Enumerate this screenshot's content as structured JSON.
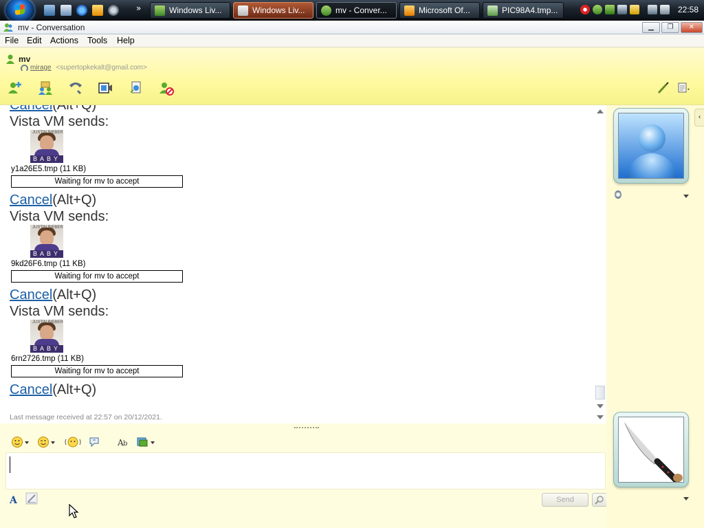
{
  "taskbar": {
    "overflow": "»",
    "buttons": [
      {
        "label": "Windows Liv..."
      },
      {
        "label": "Windows Liv..."
      },
      {
        "label": "mv - Conver..."
      },
      {
        "label": "Microsoft Of..."
      },
      {
        "label": "PIC98A4.tmp..."
      }
    ],
    "clock": "22:58"
  },
  "window": {
    "title": "mv - Conversation",
    "minimize": "▁",
    "restore": "❐",
    "close": "✕"
  },
  "menu": [
    "File",
    "Edit",
    "Actions",
    "Tools",
    "Help"
  ],
  "contact": {
    "name": "mv",
    "nickname": "mirage",
    "email": "<supertopkekalt@gmail.com>"
  },
  "history": {
    "first_cancel": "Cancel",
    "first_shortcut": "(Alt+Q)",
    "transfers": [
      {
        "sender": "Vista VM sends:",
        "thumb_caption": "BABY",
        "thumb_topline": "JUSTIN BIEBER",
        "filename": "y1a26E5.tmp (11 KB)",
        "status": "Waiting for mv to accept",
        "cancel": "Cancel",
        "shortcut": "(Alt+Q)"
      },
      {
        "sender": "Vista VM sends:",
        "thumb_caption": "BABY",
        "thumb_topline": "JUSTIN BIEBER",
        "filename": "9kd26F6.tmp (11 KB)",
        "status": "Waiting for mv to accept",
        "cancel": "Cancel",
        "shortcut": "(Alt+Q)"
      },
      {
        "sender": "Vista VM sends:",
        "thumb_caption": "BABY",
        "thumb_topline": "JUSTIN BIEBER",
        "filename": "6rn2726.tmp (11 KB)",
        "status": "Waiting for mv to accept",
        "cancel": "Cancel",
        "shortcut": "(Alt+Q)"
      }
    ],
    "last_message": "Last message received at 22:57 on 20/12/2021."
  },
  "compose": {
    "value": "",
    "send_label": "Send"
  },
  "colors": {
    "header_yellow": "#fffaa0",
    "link_blue": "#1b5fa7",
    "taskbar": "#1b232c"
  },
  "icons": {
    "toolbar": [
      "invite-contact-icon",
      "share-files-icon",
      "call-icon",
      "video-call-icon",
      "activities-icon",
      "block-icon",
      "background-paint-icon",
      "display-options-icon"
    ],
    "compose": [
      "emoticon-icon",
      "wink-icon",
      "nudge-icon",
      "voice-clip-icon",
      "font-icon",
      "color-icon"
    ]
  }
}
